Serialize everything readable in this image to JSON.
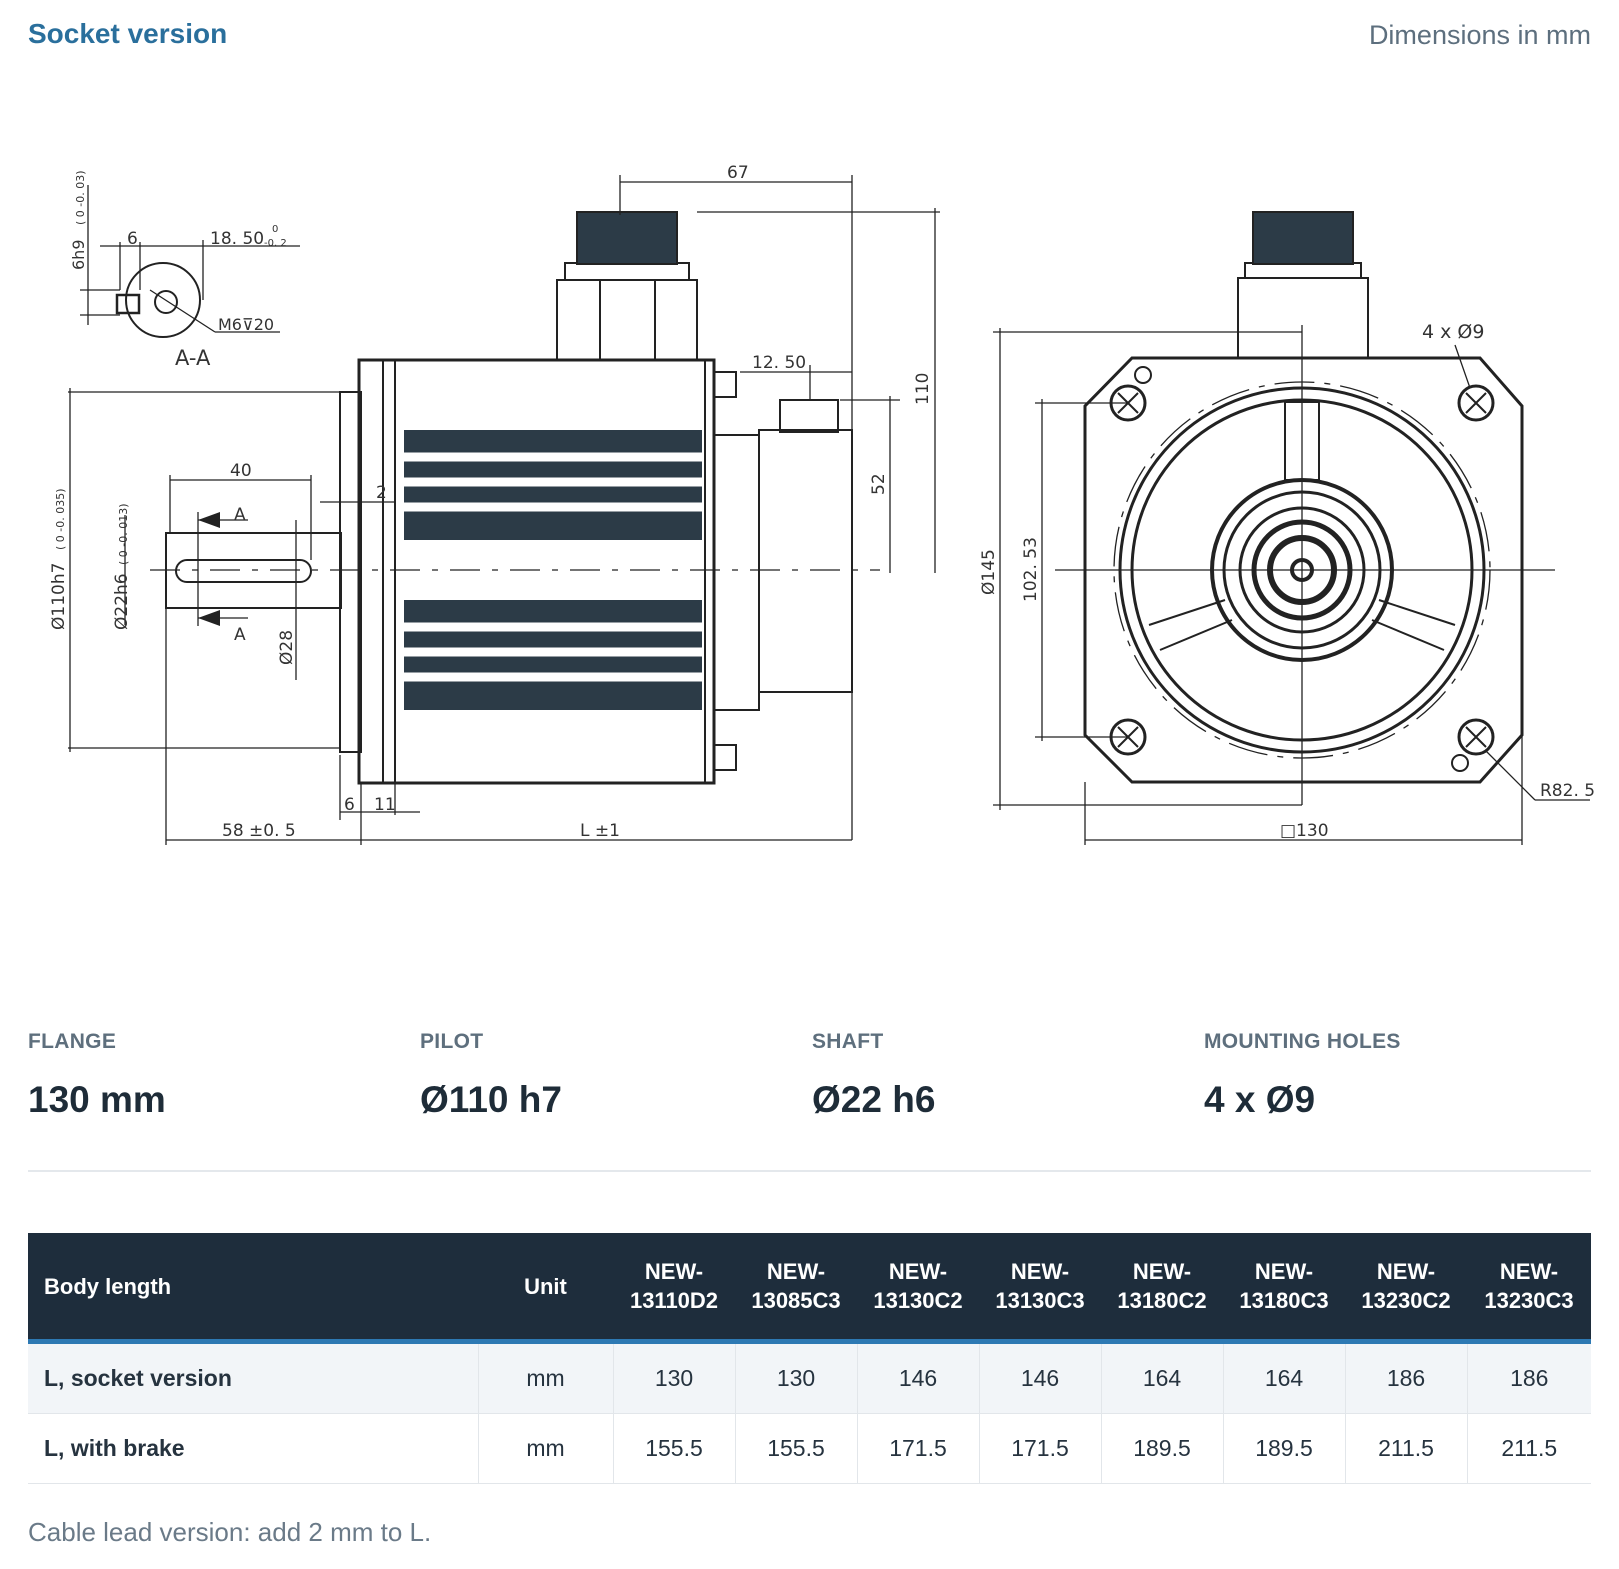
{
  "header": {
    "title": "Socket version",
    "units": "Dimensions in mm"
  },
  "drawing": {
    "section": {
      "label": "A-A",
      "dim_6": "6",
      "dim_1850": "18. 50",
      "tol_1850_upper": "0",
      "tol_1850_lower": "-0. 2",
      "dim_6h9": "6h9",
      "tol_6h9": "( 0 -0. 03)",
      "thread": "M6⊽20"
    },
    "side": {
      "dim_67": "67",
      "dim_110": "110",
      "dim_1250": "12. 50",
      "dim_52": "52",
      "dim_40": "40",
      "dim_2": "2",
      "dim_110h7": "Ø110h7",
      "tol_110h7": "( 0 -0. 035)",
      "dim_22h6": "Ø22h6",
      "tol_22h6": "( 0 -0. 013)",
      "dim_28": "Ø28",
      "marker_a": "A",
      "dim_6b": "6",
      "dim_11": "11",
      "dim_58": "58 ±0. 5",
      "dim_l": "L ±1"
    },
    "front": {
      "holes": "4 x Ø9",
      "dim_145": "Ø145",
      "dim_10253": "102. 53",
      "dim_130": "□130",
      "dim_r": "R82. 5"
    }
  },
  "specs": [
    {
      "label": "FLANGE",
      "value": "130 mm"
    },
    {
      "label": "PILOT",
      "value": "Ø110 h7"
    },
    {
      "label": "SHAFT",
      "value": "Ø22 h6"
    },
    {
      "label": "MOUNTING HOLES",
      "value": "4 x Ø9"
    }
  ],
  "table": {
    "header_label": "Body length",
    "header_unit": "Unit",
    "models": [
      {
        "line1": "NEW-",
        "line2": "13110D2"
      },
      {
        "line1": "NEW-",
        "line2": "13085C3"
      },
      {
        "line1": "NEW-",
        "line2": "13130C2"
      },
      {
        "line1": "NEW-",
        "line2": "13130C3"
      },
      {
        "line1": "NEW-",
        "line2": "13180C2"
      },
      {
        "line1": "NEW-",
        "line2": "13180C3"
      },
      {
        "line1": "NEW-",
        "line2": "13230C2"
      },
      {
        "line1": "NEW-",
        "line2": "13230C3"
      }
    ],
    "rows": [
      {
        "label": "L, socket version",
        "unit": "mm",
        "values": [
          "130",
          "130",
          "146",
          "146",
          "164",
          "164",
          "186",
          "186"
        ]
      },
      {
        "label": "L, with brake",
        "unit": "mm",
        "values": [
          "155.5",
          "155.5",
          "171.5",
          "171.5",
          "189.5",
          "189.5",
          "211.5",
          "211.5"
        ]
      }
    ]
  },
  "footnote": "Cable lead version: add 2 mm to L."
}
